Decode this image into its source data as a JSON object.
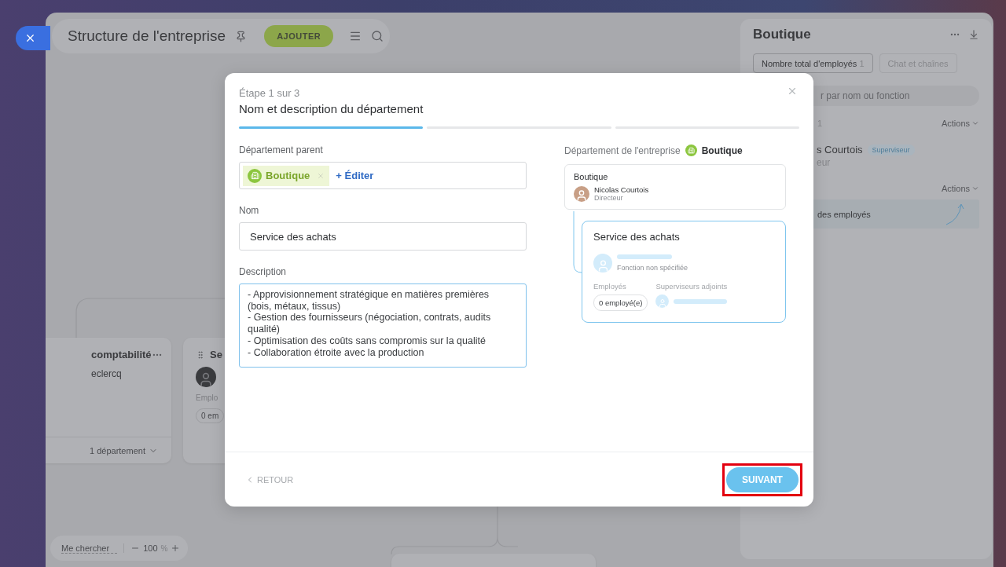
{
  "header": {
    "title": "Structure de l'entreprise",
    "add_button": "AJOUTER"
  },
  "chart_nodes": [
    {
      "kind": "full",
      "title": "comptabilité",
      "person": "eclercq",
      "footer": "1 département"
    },
    {
      "kind": "partial",
      "title": "Se",
      "employees_label": "Emplo",
      "employees_count": "0 em"
    }
  ],
  "zoom_bar": {
    "find_me": "Me chercher",
    "level": "100",
    "unit": "%"
  },
  "panel": {
    "title": "Boutique",
    "tabs": [
      {
        "label": "Nombre total d'employés",
        "count": "1",
        "selected": true
      },
      {
        "label": "Chat et chaînes",
        "selected": false
      }
    ],
    "search_placeholder": "r par nom ou fonction",
    "group_count": "1",
    "actions": [
      "Actions",
      "Actions"
    ],
    "person": {
      "name": "s Courtois",
      "badge": "Superviseur",
      "role": "eur"
    },
    "row": "des employés"
  },
  "modal": {
    "step": "Étape 1 sur 3",
    "title": "Nom et description du département",
    "progress": [
      {
        "active": true
      },
      {
        "active": false
      },
      {
        "active": false
      }
    ],
    "parent_label": "Département parent",
    "parent_tag": "Boutique",
    "edit_link": "+ Éditer",
    "name_label": "Nom",
    "name_value": "Service des achats",
    "description_label": "Description",
    "description_value": "- Approvisionnement stratégique en matières premières (bois, métaux, tissus)\n- Gestion des fournisseurs (négociation, contrats, audits qualité)\n- Optimisation des coûts sans compromis sur la qualité\n- Collaboration étroite avec la production",
    "preview": {
      "label": "Département de l'entreprise",
      "department": "Boutique",
      "parent_card": {
        "title": "Boutique",
        "person": "Nicolas Courtois",
        "role": "Directeur"
      },
      "new_card": {
        "title": "Service des achats",
        "role_placeholder": "Fonction non spécifiée",
        "employees_label": "Employés",
        "employees_count": "0 employé(e)",
        "deputies_label": "Superviseurs adjoints"
      }
    },
    "back_button": "RETOUR",
    "next_button": "SUIVANT",
    "next_highlighted": true
  }
}
